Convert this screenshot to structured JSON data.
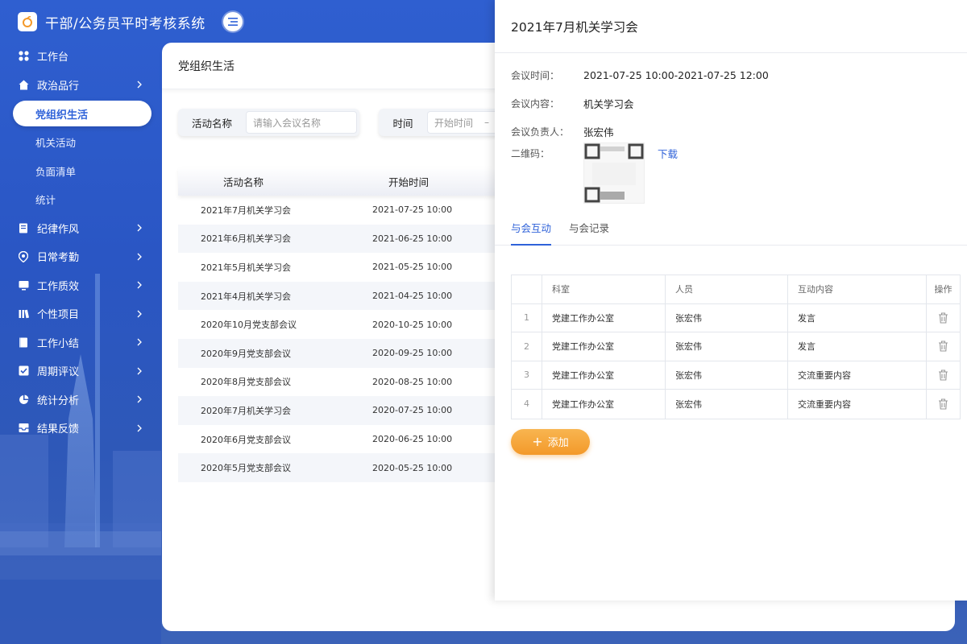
{
  "app": {
    "title": "干部/公务员平时考核系统"
  },
  "sidebar": {
    "items": [
      {
        "label": "工作台",
        "icon": "grid-icon",
        "has_children": false
      },
      {
        "label": "政治品行",
        "icon": "home-icon",
        "has_children": true
      },
      {
        "label": "党组织生活",
        "sub": true,
        "active": true
      },
      {
        "label": "机关活动",
        "sub": true
      },
      {
        "label": "负面清单",
        "sub": true
      },
      {
        "label": "统计",
        "sub": true
      },
      {
        "label": "纪律作风",
        "icon": "document-icon",
        "has_children": true
      },
      {
        "label": "日常考勤",
        "icon": "location-icon",
        "has_children": true
      },
      {
        "label": "工作质效",
        "icon": "monitor-icon",
        "has_children": true
      },
      {
        "label": "个性项目",
        "icon": "bars-icon",
        "has_children": true
      },
      {
        "label": "工作小结",
        "icon": "notebook-icon",
        "has_children": true
      },
      {
        "label": "周期评议",
        "icon": "checkbox-icon",
        "has_children": true
      },
      {
        "label": "统计分析",
        "icon": "pie-chart-icon",
        "has_children": true
      },
      {
        "label": "结果反馈",
        "icon": "inbox-icon",
        "has_children": true
      }
    ]
  },
  "main": {
    "title": "党组织生活",
    "filters": {
      "name_label": "活动名称",
      "name_placeholder": "请输入会议名称",
      "time_label": "时间",
      "time_start_placeholder": "开始时间",
      "time_separator": "–"
    },
    "table": {
      "columns": [
        "活动名称",
        "开始时间"
      ],
      "rows": [
        [
          "2021年7月机关学习会",
          "2021-07-25 10:00"
        ],
        [
          "2021年6月机关学习会",
          "2021-06-25 10:00"
        ],
        [
          "2021年5月机关学习会",
          "2021-05-25 10:00"
        ],
        [
          "2021年4月机关学习会",
          "2021-04-25 10:00"
        ],
        [
          "2020年10月党支部会议",
          "2020-10-25 10:00"
        ],
        [
          "2020年9月党支部会议",
          "2020-09-25 10:00"
        ],
        [
          "2020年8月党支部会议",
          "2020-08-25 10:00"
        ],
        [
          "2020年7月机关学习会",
          "2020-07-25 10:00"
        ],
        [
          "2020年6月党支部会议",
          "2020-06-25 10:00"
        ],
        [
          "2020年5月党支部会议",
          "2020-05-25 10:00"
        ]
      ]
    }
  },
  "drawer": {
    "title": "2021年7月机关学习会",
    "info": {
      "time_label": "会议时间：",
      "time_value": "2021-07-25 10:00-2021-07-25 12:00",
      "content_label": "会议内容：",
      "content_value": "机关学习会",
      "owner_label": "会议负责人：",
      "owner_value": "张宏伟",
      "qr_label": "二维码：",
      "download_label": "下载"
    },
    "tabs": [
      "与会互动",
      "与会记录"
    ],
    "interaction_table": {
      "columns": [
        "",
        "科室",
        "人员",
        "互动内容",
        "操作"
      ],
      "rows": [
        {
          "index": "1",
          "dept": "党建工作办公室",
          "person": "张宏伟",
          "content": "发言"
        },
        {
          "index": "2",
          "dept": "党建工作办公室",
          "person": "张宏伟",
          "content": "发言"
        },
        {
          "index": "3",
          "dept": "党建工作办公室",
          "person": "张宏伟",
          "content": "交流重要内容"
        },
        {
          "index": "4",
          "dept": "党建工作办公室",
          "person": "张宏伟",
          "content": "交流重要内容"
        }
      ]
    },
    "add_button_label": "添加"
  },
  "colors": {
    "primary": "#2f62d9",
    "sidebar_bg": "#2a56c4",
    "add_button": "#f3992a"
  }
}
